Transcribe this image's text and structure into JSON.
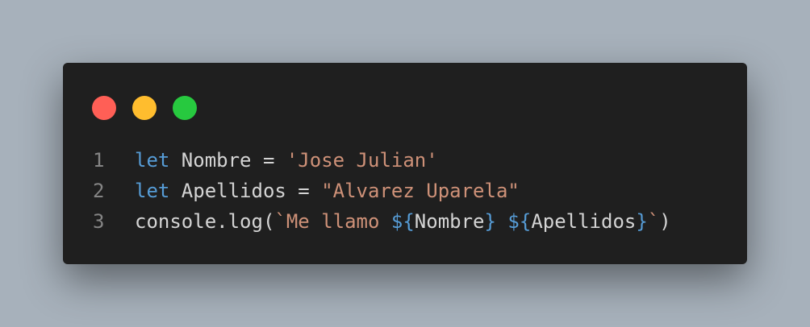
{
  "colors": {
    "background": "#a7b1bb",
    "window": "#1f1f1f",
    "keyword": "#569cd6",
    "plain": "#d4d4d4",
    "string": "#ce9178",
    "line_number": "#858585",
    "close_dot": "#ff5f56",
    "minimize_dot": "#ffbd2e",
    "maximize_dot": "#27c93f"
  },
  "code": {
    "line1": {
      "num": "1",
      "t1": "let",
      "t2": " Nombre = ",
      "t3": "'Jose Julian'"
    },
    "line2": {
      "num": "2",
      "t1": "let",
      "t2": " Apellidos = ",
      "t3": "\"Alvarez Uparela\""
    },
    "line3": {
      "num": "3",
      "t1": "console.log(",
      "t2": "`Me llamo ",
      "t3": "${",
      "t4": "Nombre",
      "t5": "}",
      "t6": " ",
      "t7": "${",
      "t8": "Apellidos",
      "t9": "}",
      "t10": "`",
      "t11": ")"
    }
  }
}
